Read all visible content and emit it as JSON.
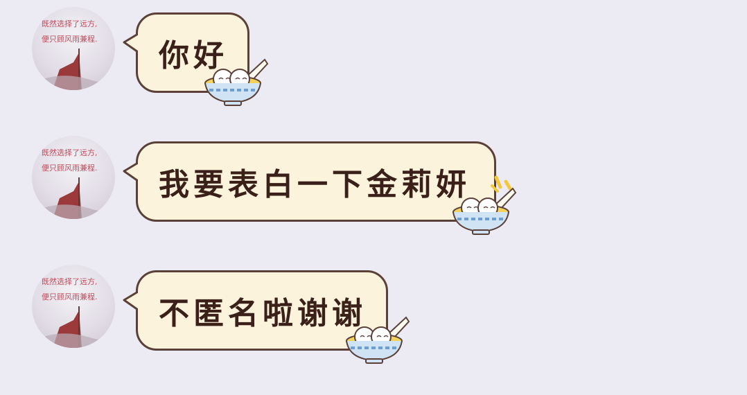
{
  "messages": [
    {
      "text": "你好"
    },
    {
      "text": "我要表白一下金莉妍"
    },
    {
      "text": "不匿名啦谢谢"
    }
  ],
  "avatar_caption": {
    "line1": "既然选择了远方,",
    "line2": "便只顾风雨兼程."
  },
  "colors": {
    "background": "#ecebf4",
    "bubble_fill": "#fbf3dc",
    "bubble_border": "#5b4038",
    "text": "#3a2019",
    "avatar_caption": "#c24a5a",
    "flag_red": "#8e1c1c"
  },
  "icons": [
    "avatar-image",
    "tangyuan-bowl-icon",
    "sparkle-icon"
  ]
}
